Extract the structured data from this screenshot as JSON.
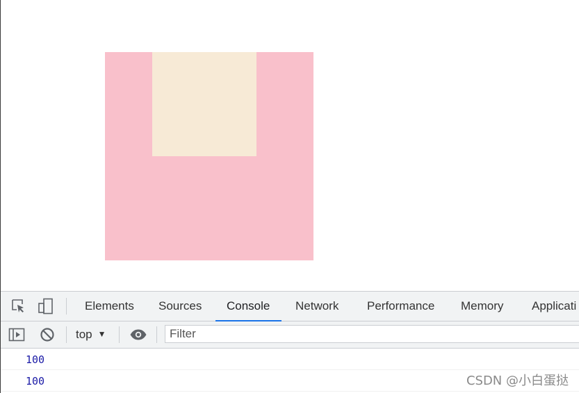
{
  "page": {
    "outer_box_color": "#f9c0cb",
    "inner_box_color": "#f7ead6"
  },
  "devtools": {
    "tabs": [
      {
        "label": "Elements",
        "active": false
      },
      {
        "label": "Sources",
        "active": false
      },
      {
        "label": "Console",
        "active": true
      },
      {
        "label": "Network",
        "active": false
      },
      {
        "label": "Performance",
        "active": false
      },
      {
        "label": "Memory",
        "active": false
      },
      {
        "label": "Applicati",
        "active": false
      }
    ],
    "toolbar_icons": [
      "inspect-element-icon",
      "device-toggle-icon"
    ],
    "accent_color": "#1a73e8",
    "console_toolbar": {
      "icons": [
        "sidebar-toggle-icon",
        "clear-console-icon",
        "eye-icon"
      ],
      "context_label": "top",
      "filter_placeholder": "Filter"
    },
    "console_output": [
      {
        "value": "100",
        "color": "#1a1aa6"
      },
      {
        "value": "100",
        "color": "#1a1aa6"
      }
    ]
  },
  "watermark": "CSDN @小白蛋挞"
}
